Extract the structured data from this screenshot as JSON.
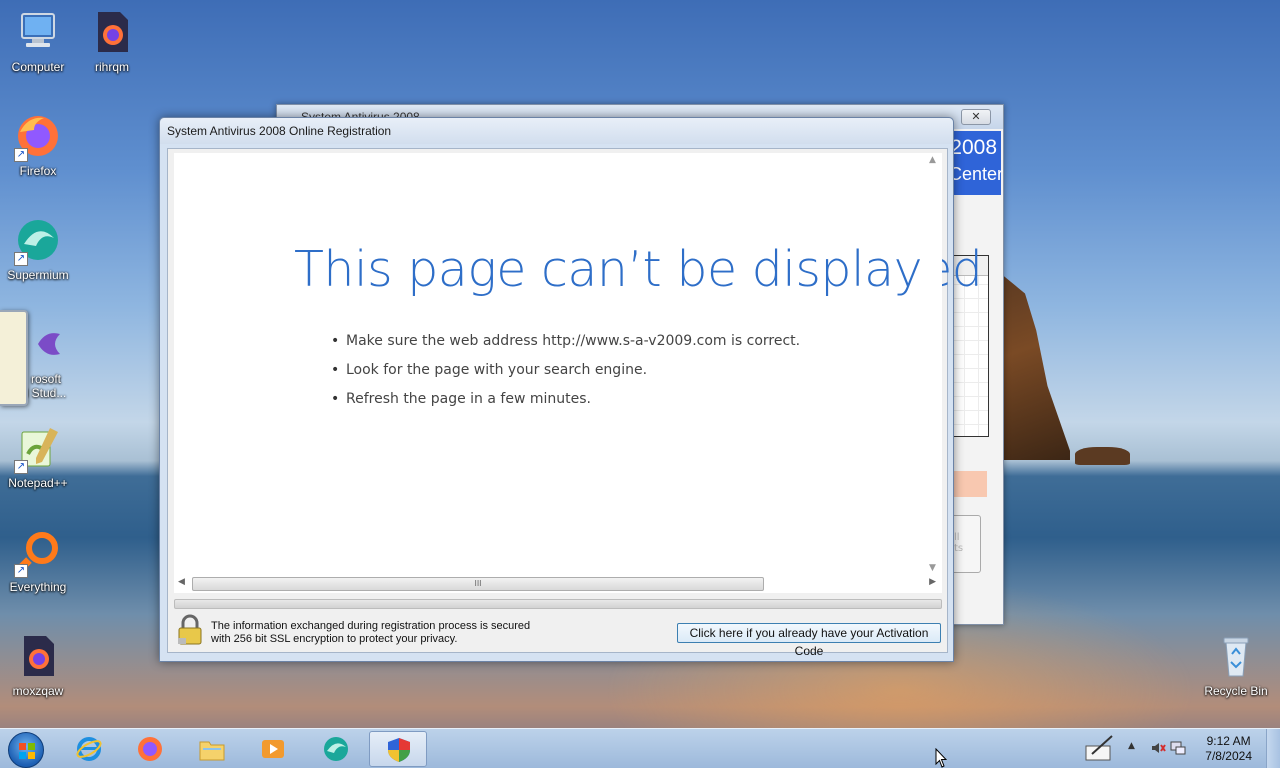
{
  "desktop": {
    "icons": [
      {
        "label": "Computer",
        "icon": "computer-icon"
      },
      {
        "label": "rihrqm",
        "icon": "firefox-file-icon"
      },
      {
        "label": "Firefox",
        "icon": "firefox-icon"
      },
      {
        "label": "Supermium",
        "icon": "supermium-icon"
      },
      {
        "label": "rosoft\n l Stud...",
        "icon": "visual-studio-icon"
      },
      {
        "label": "Notepad++",
        "icon": "notepadpp-icon"
      },
      {
        "label": "Everything",
        "icon": "everything-icon"
      },
      {
        "label": "moxzqaw",
        "icon": "firefox-file-icon"
      },
      {
        "label": "Recycle Bin",
        "icon": "recycle-bin-icon"
      }
    ]
  },
  "background_window": {
    "title": "System Antivirus 2008",
    "close_label": "✕",
    "banner_line1": "2008",
    "banner_line2": "Center",
    "button_text": "ll\nts"
  },
  "dialog": {
    "title": "System Antivirus 2008 Online Registration",
    "error_title": "This page can’t be displayed",
    "bullets": [
      "Make sure the web address http://www.s-a-v2009.com is correct.",
      "Look for the page with your search engine.",
      "Refresh the page in a few minutes."
    ],
    "secure_text_line1": "The information exchanged during registration process is secured",
    "secure_text_line2": "with 256 bit SSL encryption to protect your privacy.",
    "activation_button": "Click here if you already have your Activation Code",
    "scroll_thumb_grip": "III"
  },
  "taskbar": {
    "items": [
      {
        "name": "internet-explorer",
        "icon": "ie-icon"
      },
      {
        "name": "firefox",
        "icon": "firefox-icon"
      },
      {
        "name": "file-explorer",
        "icon": "folder-icon"
      },
      {
        "name": "media-player",
        "icon": "media-player-icon"
      },
      {
        "name": "supermium",
        "icon": "supermium-icon"
      },
      {
        "name": "system-antivirus",
        "icon": "shield-icon",
        "active": true
      }
    ],
    "clock_time": "9:12 AM",
    "clock_date": "7/8/2024"
  },
  "colors": {
    "error_title": "#2e6ec8",
    "banner": "#2f64d8",
    "taskbar": "#bcd2ea"
  }
}
